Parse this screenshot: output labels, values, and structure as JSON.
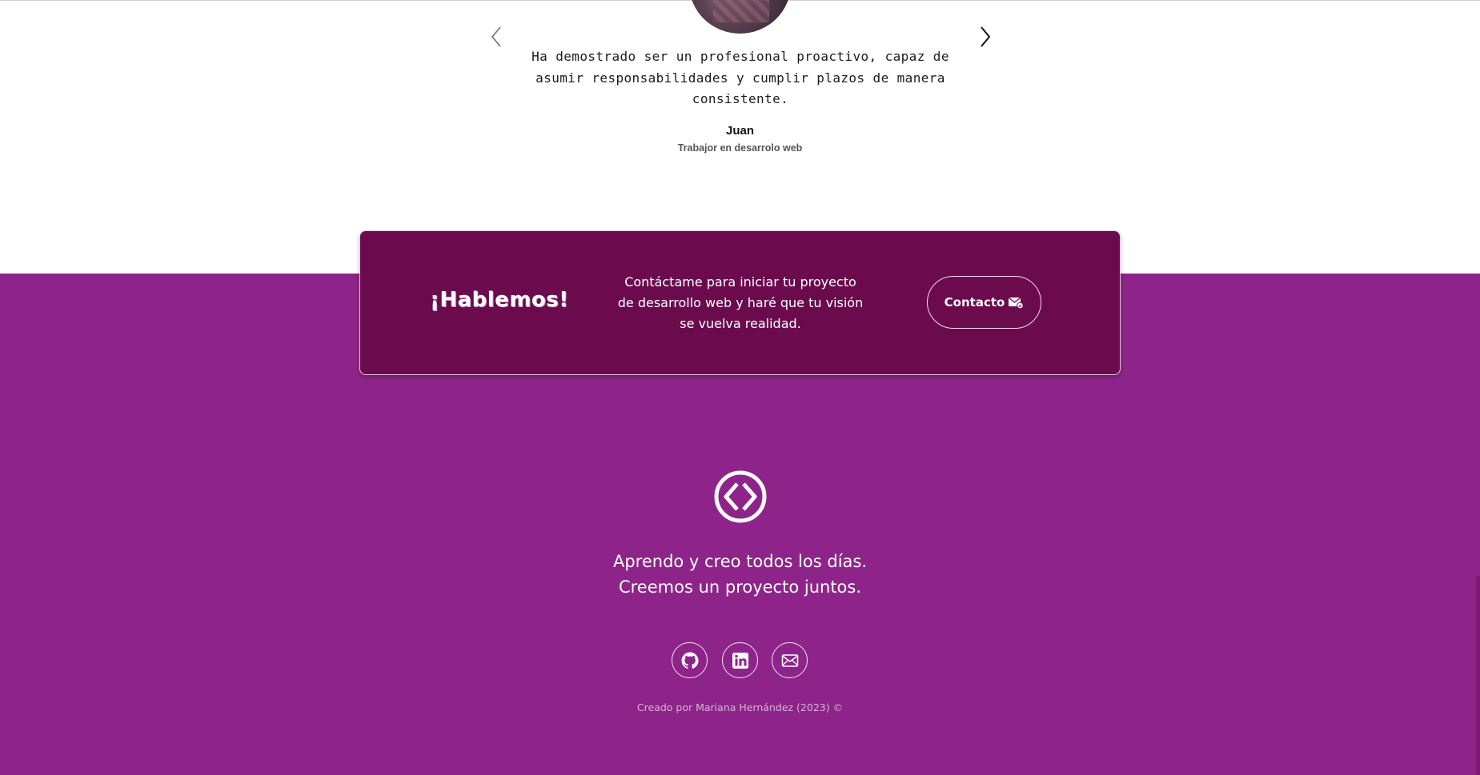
{
  "testimonial": {
    "quote": "Ha demostrado ser un profesional proactivo, capaz de asumir responsabilidades y cumplir plazos de manera consistente.",
    "author": "Juan",
    "role": "Trabajor en desarrolo web",
    "prev_icon": "chevron-left-icon",
    "next_icon": "chevron-right-icon"
  },
  "cta": {
    "title": "¡Hablemos!",
    "text": "Contáctame para iniciar tu proyecto de desarrollo web y haré que tu visión se vuelva realidad.",
    "button_label": "Contacto",
    "button_icon": "envelope-icon"
  },
  "footer": {
    "logo_icon": "code-icon",
    "tagline_line1": "Aprendo y creo todos los días.",
    "tagline_line2": "Creemos un proyecto juntos.",
    "social": [
      {
        "icon": "github-icon"
      },
      {
        "icon": "linkedin-icon"
      },
      {
        "icon": "email-icon"
      }
    ],
    "credits": "Creado por Mariana Hernández (2023) ©"
  },
  "colors": {
    "footer_bg": "#8e248a",
    "cta_bg": "#6b0b4e",
    "text_light": "#ffffff"
  }
}
